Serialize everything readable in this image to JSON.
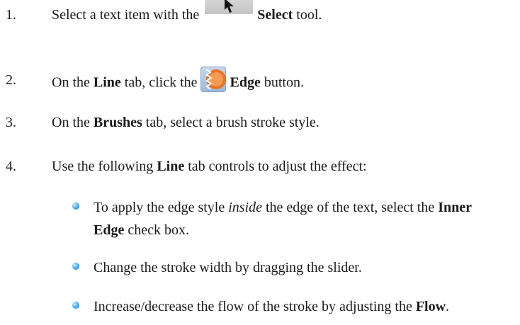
{
  "steps": [
    {
      "number": "1.",
      "pre": "Select a text item with the",
      "icon": "select-arrow-icon",
      "bold": "Select",
      "post": "tool."
    },
    {
      "number": "2.",
      "pre": "On the",
      "bold1": "Line",
      "mid": "tab, click the",
      "icon": "edge-icon",
      "bold2": "Edge",
      "post": "button."
    },
    {
      "number": "3.",
      "pre": "On the",
      "bold": "Brushes",
      "post": "tab, select a brush stroke style."
    },
    {
      "number": "4.",
      "pre": "Use the following",
      "bold": "Line",
      "post": "tab controls to adjust the effect:"
    }
  ],
  "bullets": [
    {
      "line1_pre": "To apply the edge style",
      "line1_italic": "inside",
      "line1_mid": "the edge of the text, select the",
      "line1_bold": "Inner",
      "line2_bold": "Edge",
      "line2_post": "check box."
    },
    {
      "text": "Change the stroke width by dragging the slider."
    },
    {
      "pre": "Increase/decrease the flow of the stroke by adjusting the",
      "bold": "Flow",
      "post": "."
    }
  ],
  "colors": {
    "text": "#1a1a1a",
    "bullet": "#3a9ae0",
    "edge_icon_orange": "#e8742a"
  }
}
